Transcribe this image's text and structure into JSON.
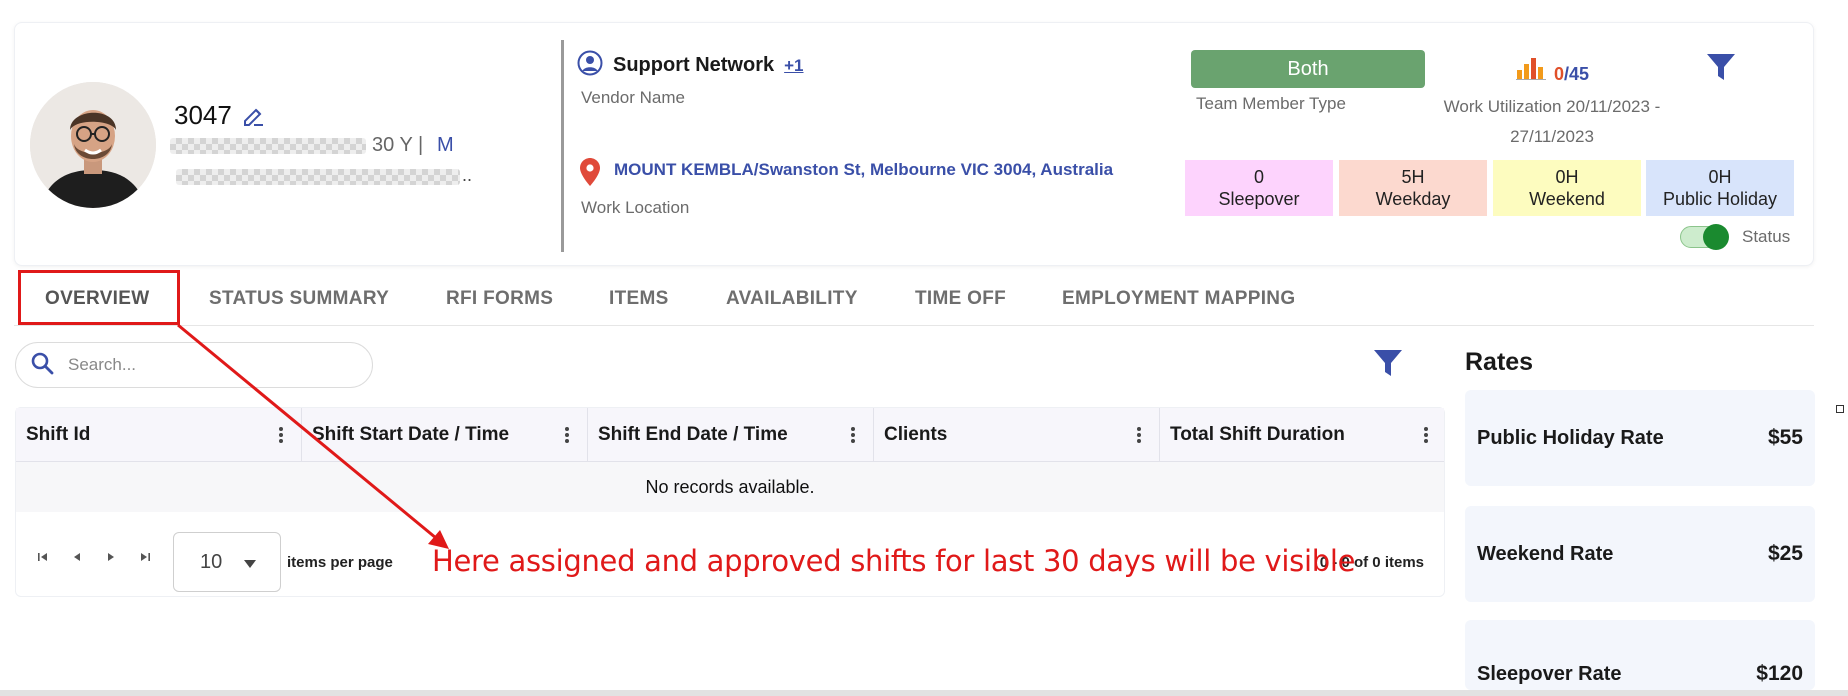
{
  "profile": {
    "employee_id": "3047",
    "age_text": "30 Y |",
    "gender": "M",
    "email_ellipsis": ".."
  },
  "support": {
    "title": "Support Network",
    "plus": "+1",
    "vendor_label": "Vendor Name",
    "location": "MOUNT KEMBLA/Swanston St, Melbourne VIC 3004, Australia",
    "location_label": "Work Location"
  },
  "team": {
    "type_value": "Both",
    "type_label": "Team Member Type"
  },
  "utilization": {
    "used": "0",
    "total": "/45",
    "label": "Work Utilization 20/11/2023 - 27/11/2023"
  },
  "stats": [
    {
      "value": "0",
      "label": "Sleepover",
      "bg": "#fdd3fd"
    },
    {
      "value": "5H",
      "label": "Weekday",
      "bg": "#fcd9cf"
    },
    {
      "value": "0H",
      "label": "Weekend",
      "bg": "#fdfcbf"
    },
    {
      "value": "0H",
      "label": "Public Holiday",
      "bg": "#d8e4fb"
    }
  ],
  "status_label": "Status",
  "tabs": [
    "OVERVIEW",
    "STATUS SUMMARY",
    "RFI FORMS",
    "ITEMS",
    "AVAILABILITY",
    "TIME OFF",
    "EMPLOYMENT MAPPING"
  ],
  "search": {
    "placeholder": "Search..."
  },
  "grid": {
    "columns": [
      "Shift Id",
      "Shift Start Date / Time",
      "Shift End Date / Time",
      "Clients",
      "Total Shift Duration"
    ],
    "empty_text": "No records available.",
    "page_size": "10",
    "items_per_page": "items per page",
    "range": "0 - 0 of 0 items"
  },
  "annotation": "Here assigned and approved shifts for last 30 days will be visible",
  "rates": {
    "title": "Rates",
    "items": [
      {
        "label": "Public Holiday Rate",
        "value": "$55"
      },
      {
        "label": "Weekend Rate",
        "value": "$25"
      },
      {
        "label": "Sleepover Rate",
        "value": "$120"
      }
    ]
  },
  "colors": {
    "accent": "#3a4fa8",
    "annotation": "#e01919",
    "badge": "#6aa36f"
  }
}
